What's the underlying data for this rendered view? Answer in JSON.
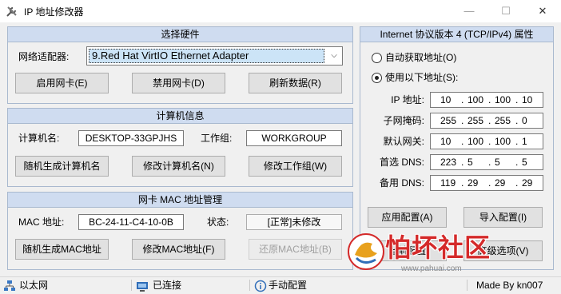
{
  "window": {
    "title": "IP 地址修改器",
    "minimize": "—",
    "maximize": "☐",
    "close": "✕"
  },
  "hardware": {
    "title": "选择硬件",
    "adapter_label": "网络适配器:",
    "adapter_value": "9.Red Hat VirtIO Ethernet Adapter",
    "enable_btn": "启用网卡(E)",
    "disable_btn": "禁用网卡(D)",
    "refresh_btn": "刷新数据(R)"
  },
  "computer": {
    "title": "计算机信息",
    "name_label": "计算机名:",
    "name_value": "DESKTOP-33GPJHS",
    "workgroup_label": "工作组:",
    "workgroup_value": "WORKGROUP",
    "random_name_btn": "随机生成计算机名",
    "modify_name_btn": "修改计算机名(N)",
    "modify_workgroup_btn": "修改工作组(W)"
  },
  "mac": {
    "title": "网卡 MAC 地址管理",
    "mac_label": "MAC 地址:",
    "mac_value": "BC-24-11-C4-10-0B",
    "state_label": "状态:",
    "state_value": "[正常]未修改",
    "random_mac_btn": "随机生成MAC地址",
    "modify_mac_btn": "修改MAC地址(F)",
    "restore_mac_btn": "还原MAC地址(B)"
  },
  "ipv4": {
    "title": "Internet 协议版本 4 (TCP/IPv4) 属性",
    "auto_label": "自动获取地址(O)",
    "manual_label": "使用以下地址(S):",
    "selected": "manual",
    "fields": [
      {
        "label": "IP 地址:",
        "octets": [
          "10",
          "100",
          "100",
          "10"
        ]
      },
      {
        "label": "子网掩码:",
        "octets": [
          "255",
          "255",
          "255",
          "0"
        ]
      },
      {
        "label": "默认网关:",
        "octets": [
          "10",
          "100",
          "100",
          "1"
        ]
      },
      {
        "label": "首选 DNS:",
        "octets": [
          "223",
          "5",
          "5",
          "5"
        ]
      },
      {
        "label": "备用 DNS:",
        "octets": [
          "119",
          "29",
          "29",
          "29"
        ]
      }
    ],
    "apply_btn": "应用配置(A)",
    "import_btn": "导入配置(I)",
    "current_btn": "当前配置",
    "advanced_btn": "高级选项(V)"
  },
  "statusbar": {
    "conn_type": "以太网",
    "conn_state": "已连接",
    "mode": "手动配置",
    "credit": "Made By kn007"
  },
  "watermark": {
    "text": "怕坏社区",
    "url": "www.pahuai.com"
  },
  "colors": {
    "group_header": "#cfdcf0",
    "group_border": "#a9b9cf",
    "watermark_red": "#d42a2a"
  }
}
